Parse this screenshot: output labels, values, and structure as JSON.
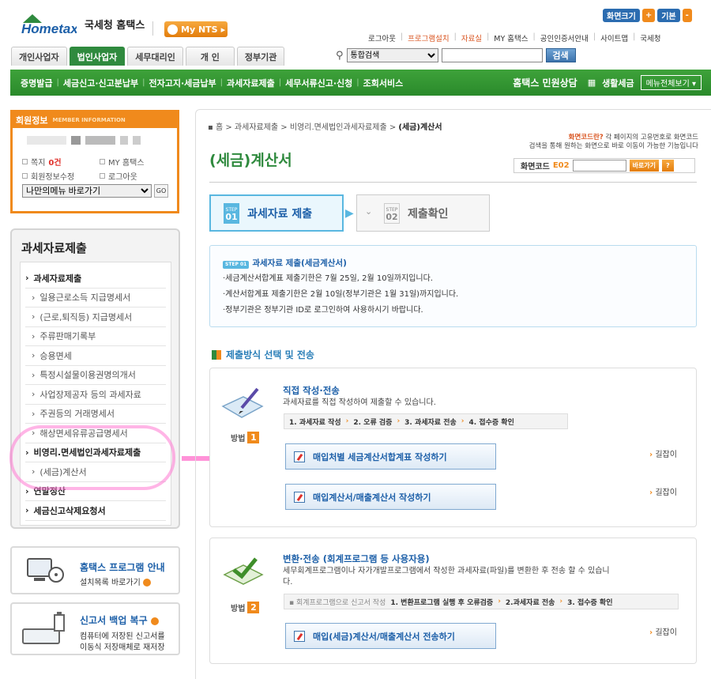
{
  "header": {
    "logo_text": "Hometax",
    "logo_korean": "국세청 홈택스",
    "my_nts": "My NTS",
    "top_buttons": {
      "screen_size": "화면크기",
      "plus": "+",
      "default": "기본",
      "minus": "-"
    },
    "util_links": [
      "로그아웃",
      "프로그램설치",
      "자료실",
      "MY 홈택스",
      "공인인증서안내",
      "사이트맵",
      "국세청"
    ],
    "tabs": [
      "개인사업자",
      "법인사업자",
      "세무대리인",
      "개 인",
      "정부기관"
    ],
    "search_select": "통합검색",
    "search_button": "검색"
  },
  "nav": {
    "items": [
      "증명발급",
      "세금신고·신고분납부",
      "전자고지·세금납부",
      "과세자료제출",
      "세무서류신고·신청",
      "조회서비스"
    ],
    "civil": "홈택스 민원상담",
    "living_tax": "생활세금",
    "menu_all": "메뉴전체보기"
  },
  "member": {
    "title": "회원정보",
    "title_en": "MEMBER INFORMATION",
    "note_label": "쪽지",
    "note_count": "0건",
    "my_hometax": "MY 홈택스",
    "edit_member": "회원정보수정",
    "logout": "로그아웃",
    "my_menu": "나만의메뉴 바로가기",
    "go": "GO"
  },
  "leftnav": {
    "title": "과세자료제출",
    "items": [
      {
        "label": "과세자료제출",
        "level": "top"
      },
      {
        "label": "일용근로소득 지급명세서",
        "level": "sub"
      },
      {
        "label": "(근로,퇴직등) 지급명세서",
        "level": "sub"
      },
      {
        "label": "주류판매기록부",
        "level": "sub"
      },
      {
        "label": "승용면세",
        "level": "sub"
      },
      {
        "label": "특정시설물이용권명의개서",
        "level": "sub"
      },
      {
        "label": "사업장제공자 등의 과세자료",
        "level": "sub"
      },
      {
        "label": "주권등의 거래명세서",
        "level": "sub"
      },
      {
        "label": "해상면세유류공급명세서",
        "level": "sub"
      },
      {
        "label": "비영리.면세법인과세자료제출",
        "level": "top"
      },
      {
        "label": "(세금)계산서",
        "level": "sub"
      },
      {
        "label": "연말정산",
        "level": "top"
      },
      {
        "label": "세금신고삭제요청서",
        "level": "top"
      }
    ]
  },
  "promos": {
    "program_title": "홈택스 프로그램 안내",
    "program_sub": "설치목록 바로가기",
    "backup_title": "신고서 백업 복구",
    "backup_sub1": "컴퓨터에 저장된 신고서를",
    "backup_sub2": "이동식 저장매체로 재저장"
  },
  "main": {
    "breadcrumb": [
      "홈",
      "과세자료제출",
      "비영리.면세법인과세자료제출",
      "(세금)계산서"
    ],
    "title": "(세금)계산서",
    "help_q": "화면코드란?",
    "help_1": "각 페이지의 고유번호로 화면코드",
    "help_2": "검색을 통해 원하는 화면으로 바로 이동이 가능한 기능입니다",
    "screen_code_label": "화면코드",
    "screen_code_value": "E02",
    "screen_code_go": "바로가기",
    "screen_code_help": "?",
    "steps": [
      {
        "step": "STEP",
        "num": "01",
        "label": "과세자료 제출"
      },
      {
        "step": "STEP",
        "num": "02",
        "label": "제출확인"
      }
    ],
    "info": {
      "badge": "STEP 01",
      "title": "과세자료 제출(세금계산서)",
      "lines": [
        "·세금계산서합계표 제출기한은 7월 25일, 2월 10일까지입니다.",
        "·계산서합계표 제출기한은 2월 10일(정부기관은 1월 31일)까지입니다.",
        "·정부기관은 정부기관 ID로 로그인하여 사용하시기 바랍니다."
      ]
    },
    "section_title": "제출방식 선택 및 전송",
    "method1": {
      "title": "직접 작성·전송",
      "desc": "과세자료를 직접 작성하여 제출할 수 있습니다.",
      "flow": [
        "1. 과세자료 작성",
        "2. 오류 검증",
        "3. 과세자료 전송",
        "4. 접수증 확인"
      ],
      "method_label": "방법",
      "method_num": "1",
      "buttons": [
        "매입처별 세금계산서합계표 작성하기",
        "매입계산서/매출계산서 작성하기"
      ],
      "guide": "길잡이"
    },
    "method2": {
      "title": "변환·전송 (회계프로그램 등 사용자용)",
      "desc1": "세무회계프로그램이나 자가개발프로그램에서 작성한 과세자료(파일)를 변환한 후 전송 할 수 있습니",
      "desc2": "다.",
      "flow_pre": "회계프로그램으로 신고서 작성",
      "flow": [
        "1. 변환프로그램 실행 후 오류검증",
        "2.과세자료 전송",
        "3. 접수증 확인"
      ],
      "method_label": "방법",
      "method_num": "2",
      "button": "매입(세금)계산서/매출계산서 전송하기",
      "guide": "길잡이"
    }
  }
}
